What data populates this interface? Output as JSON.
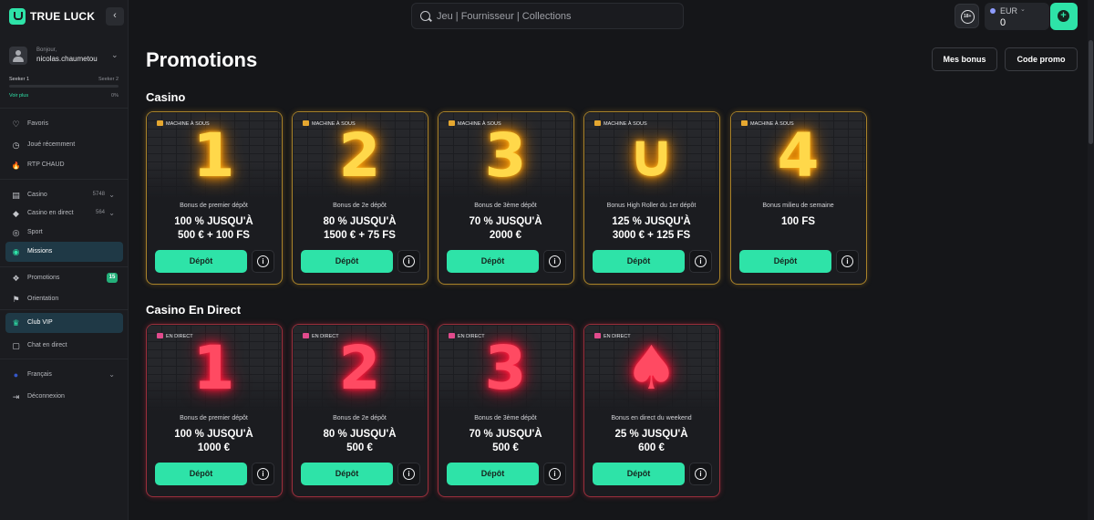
{
  "brand": {
    "name": "TRUE LUCK"
  },
  "user": {
    "greeting": "Bonjour,",
    "username": "nicolas.chaumetou"
  },
  "level": {
    "current": "Seeker 1",
    "next": "Seeker 2",
    "see_more": "Voir plus",
    "percent_label": "0%",
    "progress_fraction": 0
  },
  "sidebar": {
    "quick": [
      {
        "label": "Favoris",
        "icon": "heart-icon"
      },
      {
        "label": "Joué récemment",
        "icon": "clock-icon"
      },
      {
        "label": "RTP CHAUD",
        "icon": "fire-icon"
      }
    ],
    "games": [
      {
        "label": "Casino",
        "count": "5748",
        "icon": "slot-icon"
      },
      {
        "label": "Casino en direct",
        "count": "564",
        "icon": "live-casino-icon"
      },
      {
        "label": "Sport",
        "icon": "sport-icon"
      },
      {
        "label": "Missions",
        "icon": "mission-icon"
      }
    ],
    "promotions": {
      "label": "Promotions",
      "badge": "15",
      "icon": "gift-icon"
    },
    "orientation": {
      "label": "Orientation",
      "icon": "flag-icon"
    },
    "vip": {
      "label": "Club VIP",
      "icon": "crown-icon"
    },
    "chat": {
      "label": "Chat en direct",
      "icon": "chat-icon"
    },
    "language": {
      "label": "Français",
      "icon": "globe-icon"
    },
    "logout": {
      "label": "Déconnexion",
      "icon": "logout-icon"
    }
  },
  "header": {
    "search_placeholder": "Jeu | Fournisseur | Collections",
    "responsible_badge": "18+",
    "currency": "EUR",
    "balance": "0"
  },
  "main": {
    "title": "Promotions",
    "my_bonus": "Mes bonus",
    "promo_code": "Code promo",
    "deposit_label": "Dépôt",
    "sections": [
      {
        "title": "Casino",
        "cards": [
          {
            "tag": "MACHINE À SOUS",
            "symbol": "1",
            "subtitle": "Bonus de premier dépôt",
            "offer_line1": "100 % JUSQU'À",
            "offer_line2": "500 € + 100 FS"
          },
          {
            "tag": "MACHINE À SOUS",
            "symbol": "2",
            "subtitle": "Bonus de 2e dépôt",
            "offer_line1": "80 % JUSQU'À",
            "offer_line2": "1500 € + 75 FS"
          },
          {
            "tag": "MACHINE À SOUS",
            "symbol": "3",
            "subtitle": "Bonus de 3ème dépôt",
            "offer_line1": "70 % JUSQU'À",
            "offer_line2": "2000 €"
          },
          {
            "tag": "MACHINE À SOUS",
            "symbol": "∪",
            "subtitle": "Bonus High Roller du 1er dépôt",
            "offer_line1": "125 % JUSQU'À",
            "offer_line2": "3000 € + 125 FS"
          },
          {
            "tag": "MACHINE À SOUS",
            "symbol": "4",
            "subtitle": "Bonus milieu de semaine",
            "offer_line1": "100 FS",
            "offer_line2": ""
          }
        ]
      },
      {
        "title": "Casino En Direct",
        "cards": [
          {
            "tag": "EN DIRECT",
            "symbol": "1",
            "subtitle": "Bonus de premier dépôt",
            "offer_line1": "100 % JUSQU'À",
            "offer_line2": "1000 €"
          },
          {
            "tag": "EN DIRECT",
            "symbol": "2",
            "subtitle": "Bonus de 2e dépôt",
            "offer_line1": "80 % JUSQU'À",
            "offer_line2": "500 €"
          },
          {
            "tag": "EN DIRECT",
            "symbol": "3",
            "subtitle": "Bonus de 3ème dépôt",
            "offer_line1": "70 % JUSQU'À",
            "offer_line2": "500 €"
          },
          {
            "tag": "EN DIRECT",
            "symbol": "♠",
            "subtitle": "Bonus en direct du weekend",
            "offer_line1": "25 % JUSQU'À",
            "offer_line2": "600 €"
          }
        ]
      }
    ]
  },
  "colors": {
    "accent": "#2ee3a8",
    "gold_neon": "#ffd84a",
    "red_neon": "#ff4a62",
    "background": "#151619"
  }
}
